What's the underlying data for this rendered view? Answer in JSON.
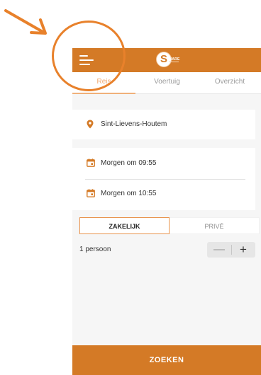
{
  "app": {
    "logo_letter": "S",
    "logo_text": "SHARE"
  },
  "tabs": [
    {
      "label": "Reis",
      "active": true
    },
    {
      "label": "Voertuig",
      "active": false
    },
    {
      "label": "Overzicht",
      "active": false
    }
  ],
  "trip": {
    "location": "Sint-Lievens-Houtem",
    "start": "Morgen om 09:55",
    "end": "Morgen om 10:55"
  },
  "segment": {
    "options": [
      "ZAKELIJK",
      "PRIVÉ"
    ],
    "selected": "ZAKELIJK"
  },
  "passengers": {
    "label": "1 persoon",
    "minus": "—",
    "plus": "+"
  },
  "search_button": "ZOEKEN",
  "colors": {
    "brand": "#d47a26",
    "annotation": "#e8812b",
    "active_tab": "#f0a56a"
  },
  "icons": [
    "menu-icon",
    "location-pin-icon",
    "calendar-icon",
    "annotation-arrow-icon"
  ]
}
